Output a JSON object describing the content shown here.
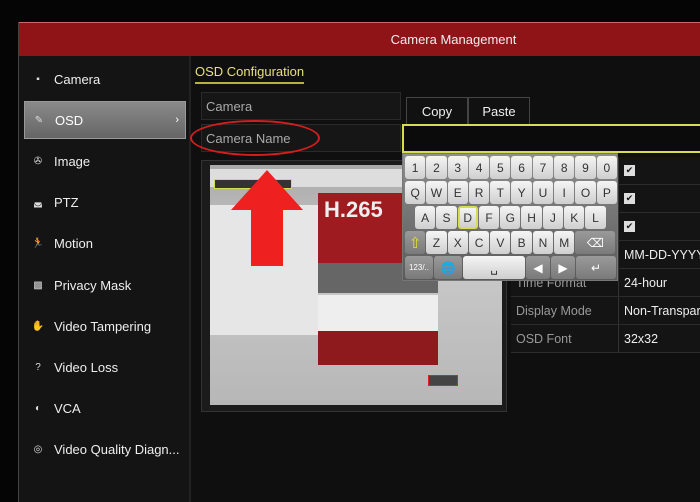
{
  "window": {
    "title": "Camera Management"
  },
  "sidebar": {
    "items": [
      {
        "label": "Camera",
        "icon": "camera-icon",
        "glyph": "▪"
      },
      {
        "label": "OSD",
        "icon": "osd-icon",
        "glyph": "✎",
        "selected": true
      },
      {
        "label": "Image",
        "icon": "image-icon",
        "glyph": "✇"
      },
      {
        "label": "PTZ",
        "icon": "ptz-icon",
        "glyph": "◛"
      },
      {
        "label": "Motion",
        "icon": "motion-icon",
        "glyph": "🏃"
      },
      {
        "label": "Privacy Mask",
        "icon": "privacy-mask-icon",
        "glyph": "▩"
      },
      {
        "label": "Video Tampering",
        "icon": "hand-icon",
        "glyph": "✋"
      },
      {
        "label": "Video Loss",
        "icon": "video-loss-icon",
        "glyph": "?"
      },
      {
        "label": "VCA",
        "icon": "vca-icon",
        "glyph": "◐"
      },
      {
        "label": "Video Quality Diagn...",
        "icon": "diagnosis-icon",
        "glyph": "◎"
      }
    ],
    "chevron": "›"
  },
  "main": {
    "section_title": "OSD Configuration",
    "camera_label": "Camera",
    "camera_name_label": "Camera Name",
    "camera_name_value": "",
    "tabs": [
      "Copy",
      "Paste"
    ],
    "preview_text": "H.265",
    "settings": [
      {
        "label": "",
        "value": "✔",
        "checkbox": true
      },
      {
        "label": "",
        "value": "✔",
        "checkbox": true
      },
      {
        "label": "",
        "value": "✔",
        "checkbox": true
      },
      {
        "label": "",
        "value": "MM-DD-YYYY"
      },
      {
        "label": "Time Format",
        "value": "24-hour"
      },
      {
        "label": "Display Mode",
        "value": "Non-Transparent"
      },
      {
        "label": "OSD Font",
        "value": "32x32"
      }
    ]
  },
  "keyboard": {
    "rows": [
      [
        "1",
        "2",
        "3",
        "4",
        "5",
        "6",
        "7",
        "8",
        "9",
        "0"
      ],
      [
        "Q",
        "W",
        "E",
        "R",
        "T",
        "Y",
        "U",
        "I",
        "O",
        "P"
      ],
      [
        "A",
        "S",
        "D",
        "F",
        "G",
        "H",
        "J",
        "K",
        "L"
      ],
      [
        "⇧",
        "Z",
        "X",
        "C",
        "V",
        "B",
        "N",
        "M",
        "⌫"
      ],
      [
        "123/..",
        "🌐",
        "␣",
        "◀",
        "▶",
        "↵"
      ]
    ],
    "highlighted": "D"
  },
  "colors": {
    "header": "#8e1418",
    "accent": "#d8dc50",
    "annotation": "#d21e1e"
  }
}
